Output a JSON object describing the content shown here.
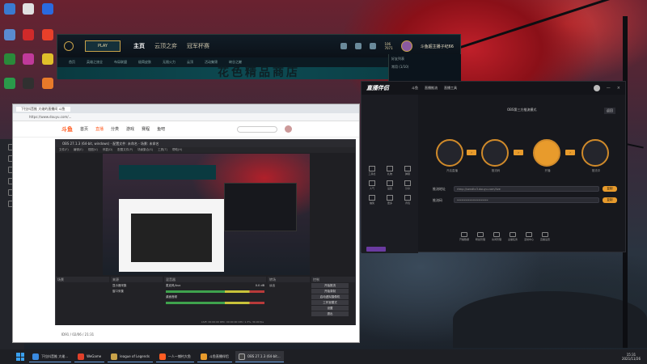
{
  "lol": {
    "play": "PLAY",
    "nav": [
      "主页",
      "云顶之弈",
      "冠军杯赛"
    ],
    "sub": [
      "首页",
      "英雄之旅全",
      "布局联盟",
      "极简皮肤",
      "无限火力",
      "云顶",
      "活动集锦",
      "峡谷之巅"
    ],
    "banner": "花色精品商店",
    "currency_1": "106",
    "currency_2": "7071",
    "username": "斗鱼超主播子纪66",
    "friends_header": "好友列表",
    "friends_group": "常用 (1/10)"
  },
  "browser": {
    "tab": "下拉抖音推 大佬的直播间 斗鱼",
    "url": "https://www.douyu.com/...",
    "logo": "斗鱼",
    "nav": [
      "首页",
      "直播",
      "分类",
      "游戏",
      "赛程",
      "鱼吧"
    ],
    "active_nav": "直播",
    "footer_text": "ID91 / 02/06 / 21:31"
  },
  "obs": {
    "title": "OBS 27.1.3 (64-bit, windows) - 配置文件: 未命名 - 场景: 未命名",
    "menu": [
      "文件(F)",
      "编辑(E)",
      "视图(V)",
      "停靠(D)",
      "配置文件(P)",
      "场景集合(S)",
      "工具(T)",
      "帮助(H)"
    ],
    "docks": [
      "场景",
      "来源",
      "混音器",
      "转场",
      "控制"
    ],
    "sources": [
      "显示器采集",
      "窗口采集"
    ],
    "mixer": [
      "麦克风/Aux",
      "桌面音频"
    ],
    "mixer_db": "0.0 dB",
    "transition": "淡出",
    "controls": [
      "开始推流",
      "开始录制",
      "启动虚拟摄像机",
      "工作室模式",
      "设置",
      "退出"
    ],
    "status": "LIVE: 00:00:00  REC: 00:00:00  CPU: 1.3%, 30.00 fps"
  },
  "assistant": {
    "logo": "直播伴侣",
    "tabs": [
      "斗鱼",
      "直播推流",
      "直播工具"
    ],
    "mode": "OBS第三方推流模式",
    "back": "返回",
    "steps": [
      "斗鱼主播",
      "OBS推流",
      "主播OBS",
      "推流完成"
    ],
    "step_labels": [
      "开启直播",
      "推流码",
      "开播",
      "推流中"
    ],
    "addr_label": "推流地址",
    "code_label": "推流码",
    "addr_value": "rtmp://sendtc3.douyu.com/live",
    "code_value": "**********************",
    "copy": "复制",
    "footer": [
      "开播数据",
      "粉丝管理",
      "房间管理",
      "主播任务",
      "活动中心",
      "直播设置"
    ],
    "side": [
      "工具栏",
      "礼物",
      "弹幕",
      "人气",
      "设置",
      "分享",
      "抽奖",
      "更多",
      "背包"
    ]
  },
  "taskbar": {
    "items": [
      "下拉抖音推 大佬...",
      "WeGame",
      "league of Legends",
      "一人一铺钓大鱼",
      "斗鱼直播伴侣",
      "OBS 27.1.3 (64-bit..."
    ],
    "time": "15:31",
    "date": "2021/11/26"
  },
  "colors": {
    "accent": "#e89b2c",
    "douyu": "#ff5d23",
    "lol_gold": "#c8a24a"
  }
}
